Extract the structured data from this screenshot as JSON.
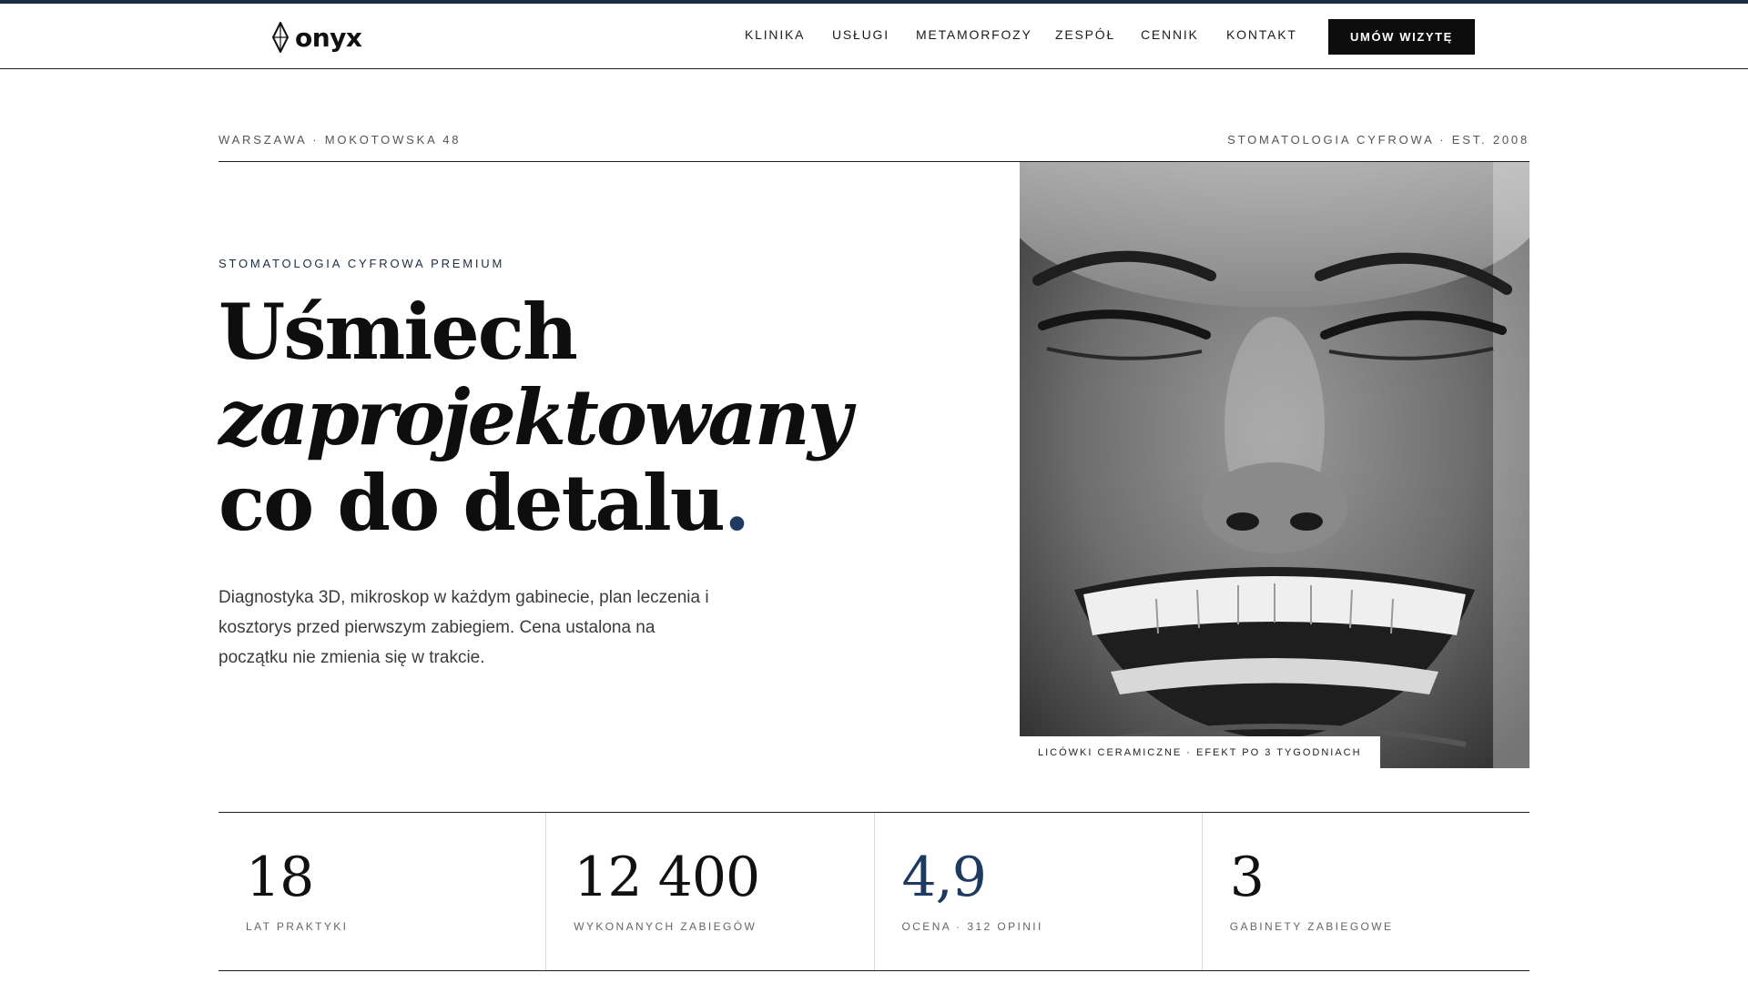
{
  "brand": {
    "name": "onyx",
    "icon": "diamond-logo-icon",
    "accent_color": "#1b2d45"
  },
  "nav": {
    "items": [
      {
        "label": "KLINIKA"
      },
      {
        "label": "USŁUGI"
      },
      {
        "label": "METAMORFOZY"
      },
      {
        "label": "ZESPÓŁ"
      },
      {
        "label": "CENNIK"
      },
      {
        "label": "KONTAKT"
      }
    ],
    "cta_label": "UMÓW WIZYTĘ"
  },
  "meta": {
    "location": "WARSZAWA · MOKOTOWSKA 48",
    "tagline": "STOMATOLOGIA CYFROWA · EST. 2008"
  },
  "hero": {
    "eyebrow": "STOMATOLOGIA CYFROWA PREMIUM",
    "headline_line1": "Uśmiech",
    "headline_line2": "zaprojektowany",
    "headline_line3": "co do detalu",
    "headline_dot": ".",
    "lead": "Diagnostyka 3D, mikroskop w każdym gabinecie, plan leczenia i kosztorys przed pierwszym zabiegiem. Cena ustalona na początku nie zmienia się w trakcie.",
    "photo_caption": "LICÓWKI CERAMICZNE · EFEKT PO 3 TYGODNIACH"
  },
  "stats": [
    {
      "value": "18",
      "label": "LAT PRAKTYKI"
    },
    {
      "value": "12 400",
      "label": "WYKONANYCH ZABIEGÓW"
    },
    {
      "value": "4,9",
      "label": "OCENA · 312 OPINII"
    },
    {
      "value": "3",
      "label": "GABINETY ZABIEGOWE"
    }
  ]
}
